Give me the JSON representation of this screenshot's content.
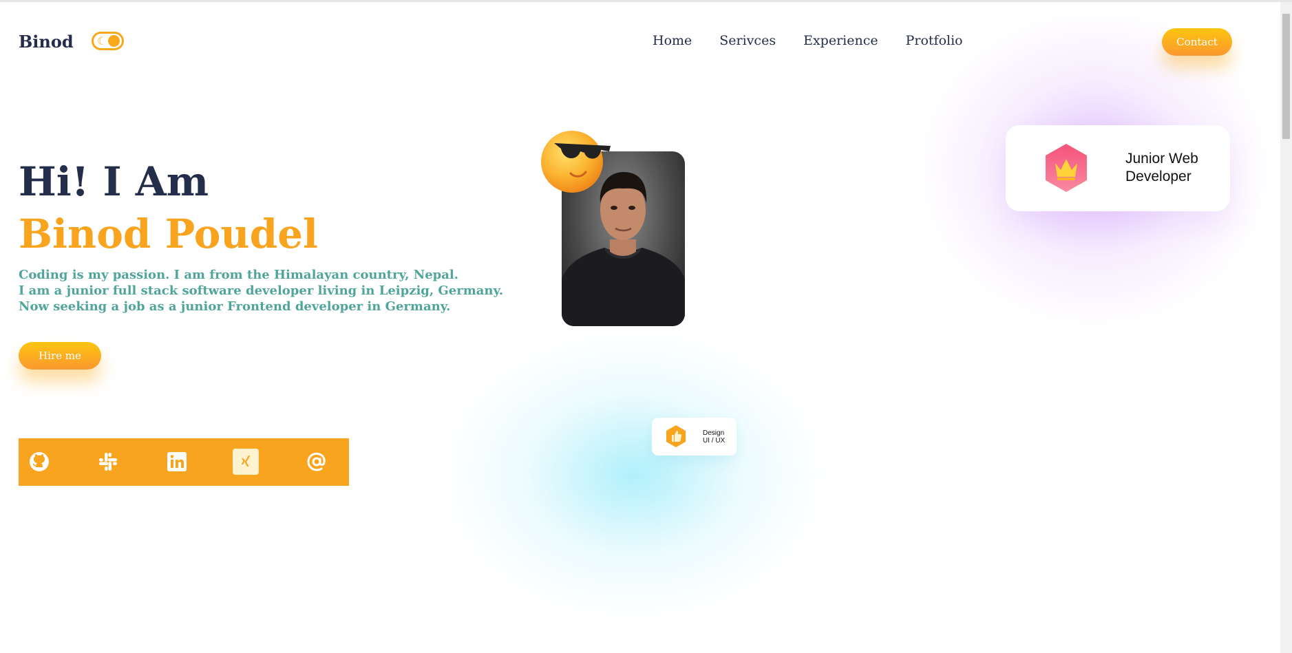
{
  "brand": {
    "logo": "Binod"
  },
  "theme_toggle": {
    "icon": "moon-icon",
    "state": "light"
  },
  "nav": {
    "items": [
      {
        "label": "Home"
      },
      {
        "label": "Serivces"
      },
      {
        "label": "Experience"
      },
      {
        "label": "Protfolio"
      }
    ]
  },
  "header": {
    "contact_label": "Contact"
  },
  "hero": {
    "greeting": "Hi! I Am",
    "name": "Binod Poudel",
    "description": [
      "Coding is my passion. I am from the Himalayan country, Nepal.",
      "I am a junior full stack software developer living in Leipzig, Germany.",
      "Now seeking a job as a junior Frontend developer in Germany."
    ],
    "hire_label": "Hire me"
  },
  "social": {
    "icons": [
      "github-icon",
      "slack-icon",
      "linkedin-icon",
      "xing-icon",
      "at-email-icon"
    ]
  },
  "cards": {
    "role": {
      "line1": "Junior Web",
      "line2": "Developer",
      "icon": "crown-icon"
    },
    "design": {
      "line1": "Design",
      "line2": "UI / UX",
      "icon": "thumbs-up-icon"
    }
  },
  "colors": {
    "accent": "#f9a41f",
    "heading": "#242d49",
    "description": "#4fa59a",
    "card_icon_pink": "#f0668a"
  }
}
